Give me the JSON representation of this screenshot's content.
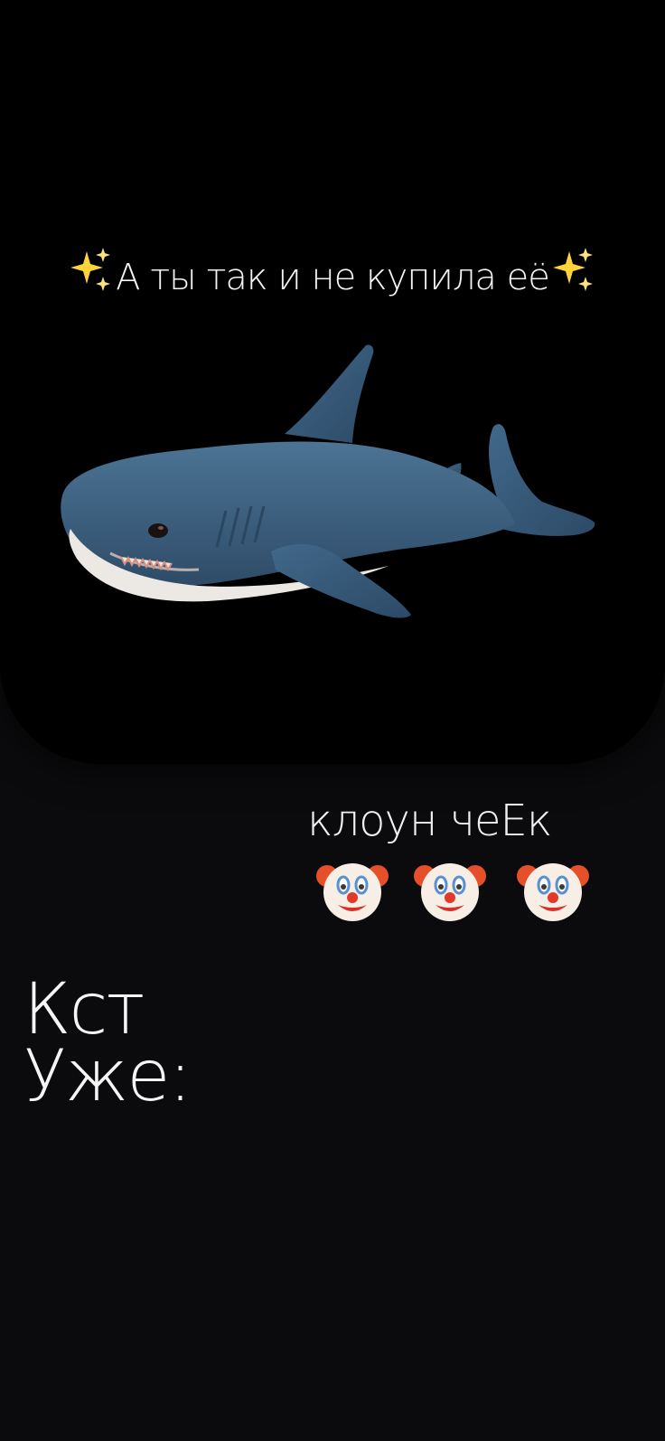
{
  "caption": {
    "text": "А ты так и не купила её",
    "sparkle_icon": "sparkles-icon"
  },
  "shark": {
    "icon": "plush-shark-image",
    "body_color": "#3c5f7e",
    "belly_color": "#ece8e4"
  },
  "clown_line": {
    "text": "клоун чеЕк",
    "emoji_icon": "clown-face-icon",
    "emoji_count": 3
  },
  "bottom_text": {
    "line1": "Кст",
    "line2": "Уже:"
  }
}
